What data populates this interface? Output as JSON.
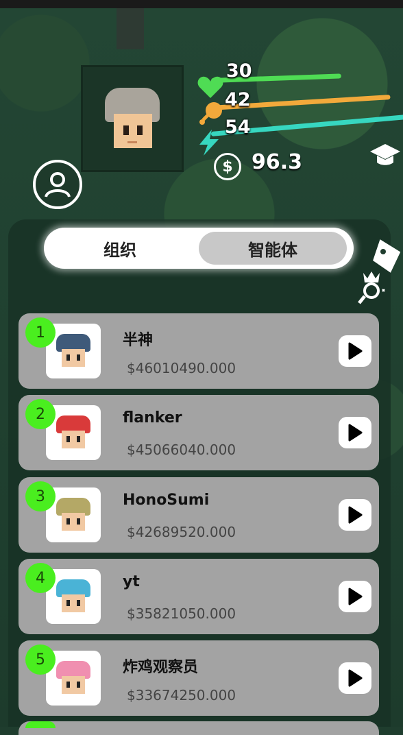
{
  "stats": {
    "health": {
      "value": "30",
      "color": "#4fdc54",
      "icon": "heart-icon",
      "level": 0.55
    },
    "food": {
      "value": "42",
      "color": "#f2a93b",
      "icon": "drumstick-icon",
      "level": 0.85
    },
    "energy": {
      "value": "54",
      "color": "#37d7c0",
      "icon": "lightning-icon",
      "level": 1.0
    },
    "money": {
      "value": "96.3",
      "icon": "coin-icon",
      "symbol": "$"
    }
  },
  "tabs": {
    "organization": "组织",
    "agent": "智能体",
    "active": "agent"
  },
  "leaderboard": [
    {
      "rank": "1",
      "name": "半神",
      "money": "$46010490.000",
      "hair": "#3f5a7a"
    },
    {
      "rank": "2",
      "name": "flanker",
      "money": "$45066040.000",
      "hair": "#d93a3a"
    },
    {
      "rank": "3",
      "name": "HonoSumi",
      "money": "$42689520.000",
      "hair": "#b4a866"
    },
    {
      "rank": "4",
      "name": "yt",
      "money": "$35821050.000",
      "hair": "#4ab3d6"
    },
    {
      "rank": "5",
      "name": "炸鸡观察员",
      "money": "$33674250.000",
      "hair": "#f08fb0"
    }
  ],
  "colors": {
    "rank_badge": "#4aee1f",
    "row_bg": "#a3a3a3",
    "panel": "#183225"
  }
}
